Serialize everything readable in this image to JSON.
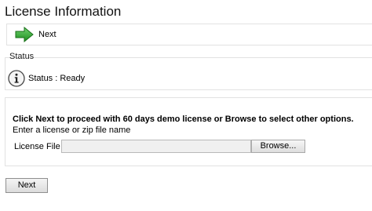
{
  "page": {
    "title": "License Information"
  },
  "toolbar": {
    "next_label": "Next",
    "next_icon": "arrow-right-icon",
    "arrow_color": "#2fa12f"
  },
  "status": {
    "legend": "Status",
    "icon": "info-icon",
    "text": "Status : Ready"
  },
  "license": {
    "instruction": "Click Next to proceed with 60 days demo license or Browse to select other options.",
    "hint": "Enter a license or zip file name",
    "file_label": "License File",
    "file_value": "",
    "browse_label": "Browse..."
  },
  "footer": {
    "next_label": "Next"
  }
}
